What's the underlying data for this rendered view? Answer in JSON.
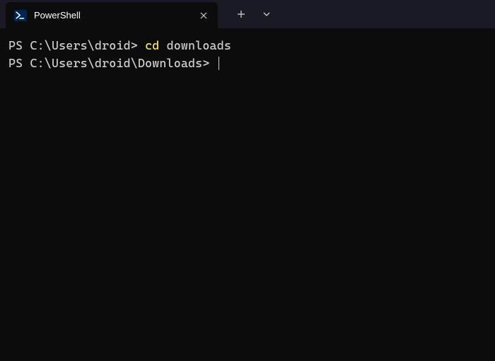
{
  "tab": {
    "title": "PowerShell",
    "icon": "powershell-icon"
  },
  "terminal": {
    "lines": [
      {
        "prompt": "PS C:\\Users\\droid>",
        "cmd": "cd",
        "arg": "downloads"
      },
      {
        "prompt": "PS C:\\Users\\droid\\Downloads>",
        "cmd": "",
        "arg": ""
      }
    ]
  }
}
